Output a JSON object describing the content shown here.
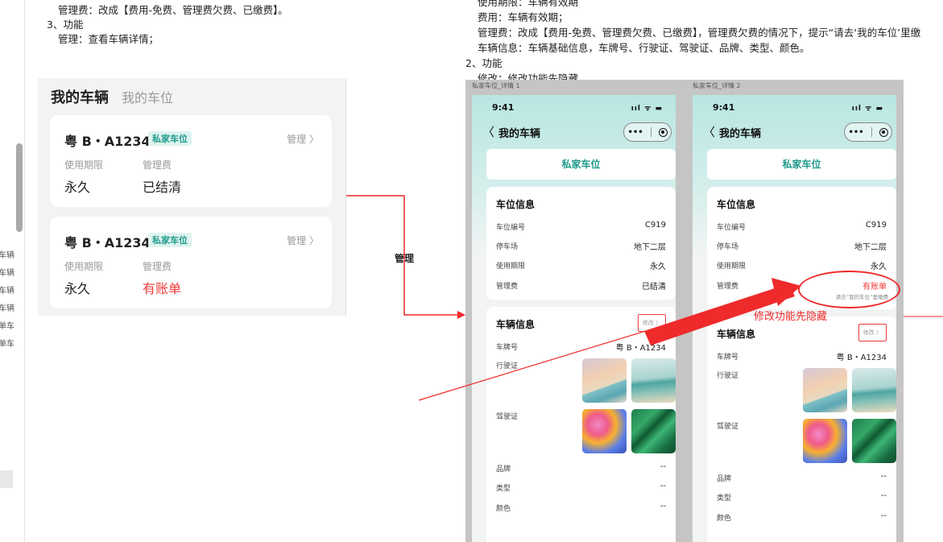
{
  "left_strip": {
    "items": [
      "车辆",
      "车辆",
      "车辆",
      "车辆",
      "单车",
      "单车"
    ]
  },
  "doc_left": {
    "line1": "管理费：改成【费用-免费、管理费欠费、已缴费】。",
    "line2": "3、功能",
    "line3": "管理：查看车辆详情；"
  },
  "doc_right": {
    "line0": "使用期限：车辆有效期",
    "line1": "费用：车辆有效期；",
    "line2": "管理费：改成【费用-免费、管理费欠费、已缴费】，管理费欠费的情况下，提示“请去‘我的车位’里缴",
    "line3": "车辆信息：车辆基础信息，车牌号、行驶证、驾驶证、品牌、类型、颜色。",
    "line4": "2、功能",
    "line5": "修改：修改功能先隐藏。"
  },
  "card_panel": {
    "tab_active": "我的车辆",
    "tab_inactive": "我的车位",
    "cards": [
      {
        "plate": "粤 B・A1234",
        "badge": "私家车位",
        "manage": "管理 〉",
        "label_period": "使用期限",
        "label_fee": "管理费",
        "period": "永久",
        "fee": "已结清"
      },
      {
        "plate": "粤 B・A1234",
        "badge": "私家车位",
        "manage": "管理 〉",
        "label_period": "使用期限",
        "label_fee": "管理费",
        "period": "永久",
        "fee": "有账单"
      }
    ]
  },
  "arrow_label": "管理",
  "artboards": {
    "name1": "私家车位_详情 1",
    "name2": "私家车位_详情 2"
  },
  "phone": {
    "time": "9:41",
    "status_icons": "ııl ᯤ ▬",
    "back": "〈",
    "title": "我的车辆",
    "capsule_more": "•••",
    "spot_tab": "私家车位",
    "spot_info": {
      "title": "车位信息",
      "rows": [
        {
          "label": "车位编号",
          "value": "C919"
        },
        {
          "label": "停车场",
          "value": "地下二层"
        },
        {
          "label": "使用期限",
          "value": "永久"
        },
        {
          "label": "管理费",
          "value": "已结清"
        }
      ],
      "fee_unpaid": "有账单",
      "fee_hint": "请去“我的车位”里缴费"
    },
    "vehicle_info": {
      "title": "车辆信息",
      "edit": "修改 〉",
      "plate_label": "车牌号",
      "plate_value": "粤 B・A1234",
      "license_label": "行驶证",
      "driver_label": "驾驶证",
      "brand_label": "品牌",
      "brand_value": "--",
      "type_label": "类型",
      "type_value": "--",
      "color_label": "颜色",
      "color_value": "--"
    }
  },
  "annotation": {
    "note": "修改功能先隐藏"
  },
  "colors": {
    "teal": "#1f9a8c",
    "red": "#ef3a3a",
    "phone_bg": "#b8e6e2"
  }
}
